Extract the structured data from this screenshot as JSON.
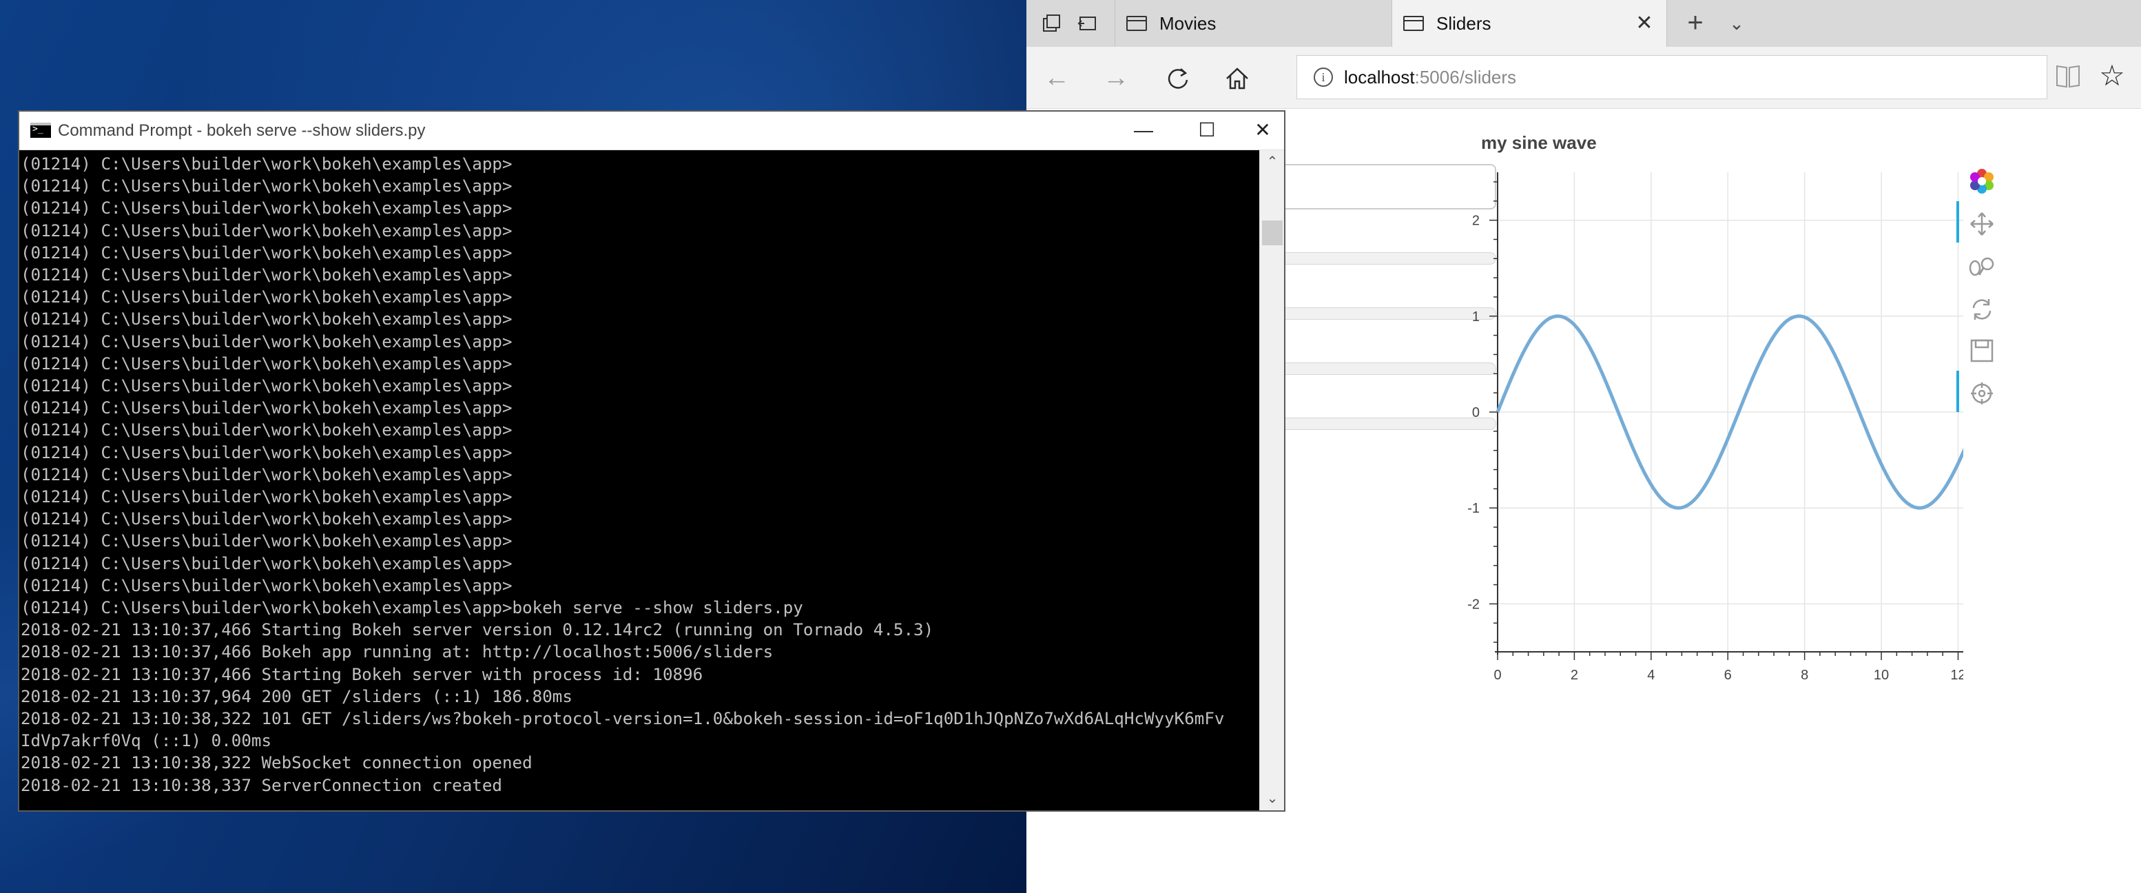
{
  "browser": {
    "tabs": [
      {
        "label": "Movies",
        "active": false
      },
      {
        "label": "Sliders",
        "active": true
      }
    ],
    "address": {
      "host": "localhost",
      "path": ":5006/sliders"
    }
  },
  "plot": {
    "title": "my sine wave",
    "line_color": "#76acd6",
    "tools": [
      "bokeh-logo-icon",
      "pan-icon",
      "box-zoom-icon",
      "reset-icon",
      "save-icon",
      "hover-icon"
    ]
  },
  "chart_data": {
    "type": "line",
    "title": "my sine wave",
    "xlabel": "",
    "ylabel": "",
    "xlim": [
      0,
      12.566
    ],
    "ylim": [
      -2.5,
      2.5
    ],
    "x_ticks": [
      0,
      2,
      4,
      6,
      8,
      10,
      12
    ],
    "y_ticks": [
      2,
      1,
      0,
      -1,
      -2
    ],
    "grid": true,
    "series": [
      {
        "function": "y = sin(x)",
        "x_start": 0,
        "x_end": 12.566
      }
    ]
  },
  "cmd": {
    "title": "Command Prompt - bokeh  serve --show sliders.py",
    "lines": [
      "(01214) C:\\Users\\builder\\work\\bokeh\\examples\\app>",
      "(01214) C:\\Users\\builder\\work\\bokeh\\examples\\app>",
      "(01214) C:\\Users\\builder\\work\\bokeh\\examples\\app>",
      "(01214) C:\\Users\\builder\\work\\bokeh\\examples\\app>",
      "(01214) C:\\Users\\builder\\work\\bokeh\\examples\\app>",
      "(01214) C:\\Users\\builder\\work\\bokeh\\examples\\app>",
      "(01214) C:\\Users\\builder\\work\\bokeh\\examples\\app>",
      "(01214) C:\\Users\\builder\\work\\bokeh\\examples\\app>",
      "(01214) C:\\Users\\builder\\work\\bokeh\\examples\\app>",
      "(01214) C:\\Users\\builder\\work\\bokeh\\examples\\app>",
      "(01214) C:\\Users\\builder\\work\\bokeh\\examples\\app>",
      "(01214) C:\\Users\\builder\\work\\bokeh\\examples\\app>",
      "(01214) C:\\Users\\builder\\work\\bokeh\\examples\\app>",
      "(01214) C:\\Users\\builder\\work\\bokeh\\examples\\app>",
      "(01214) C:\\Users\\builder\\work\\bokeh\\examples\\app>",
      "(01214) C:\\Users\\builder\\work\\bokeh\\examples\\app>",
      "(01214) C:\\Users\\builder\\work\\bokeh\\examples\\app>",
      "(01214) C:\\Users\\builder\\work\\bokeh\\examples\\app>",
      "(01214) C:\\Users\\builder\\work\\bokeh\\examples\\app>",
      "(01214) C:\\Users\\builder\\work\\bokeh\\examples\\app>",
      "(01214) C:\\Users\\builder\\work\\bokeh\\examples\\app>bokeh serve --show sliders.py",
      "2018-02-21 13:10:37,466 Starting Bokeh server version 0.12.14rc2 (running on Tornado 4.5.3)",
      "2018-02-21 13:10:37,466 Bokeh app running at: http://localhost:5006/sliders",
      "2018-02-21 13:10:37,466 Starting Bokeh server with process id: 10896",
      "2018-02-21 13:10:37,964 200 GET /sliders (::1) 186.80ms",
      "2018-02-21 13:10:38,322 101 GET /sliders/ws?bokeh-protocol-version=1.0&bokeh-session-id=oF1q0D1hJQpNZo7wXd6ALqHcWyyK6mFv",
      "IdVp7akrf0Vq (::1) 0.00ms",
      "2018-02-21 13:10:38,322 WebSocket connection opened",
      "2018-02-21 13:10:38,337 ServerConnection created"
    ]
  }
}
